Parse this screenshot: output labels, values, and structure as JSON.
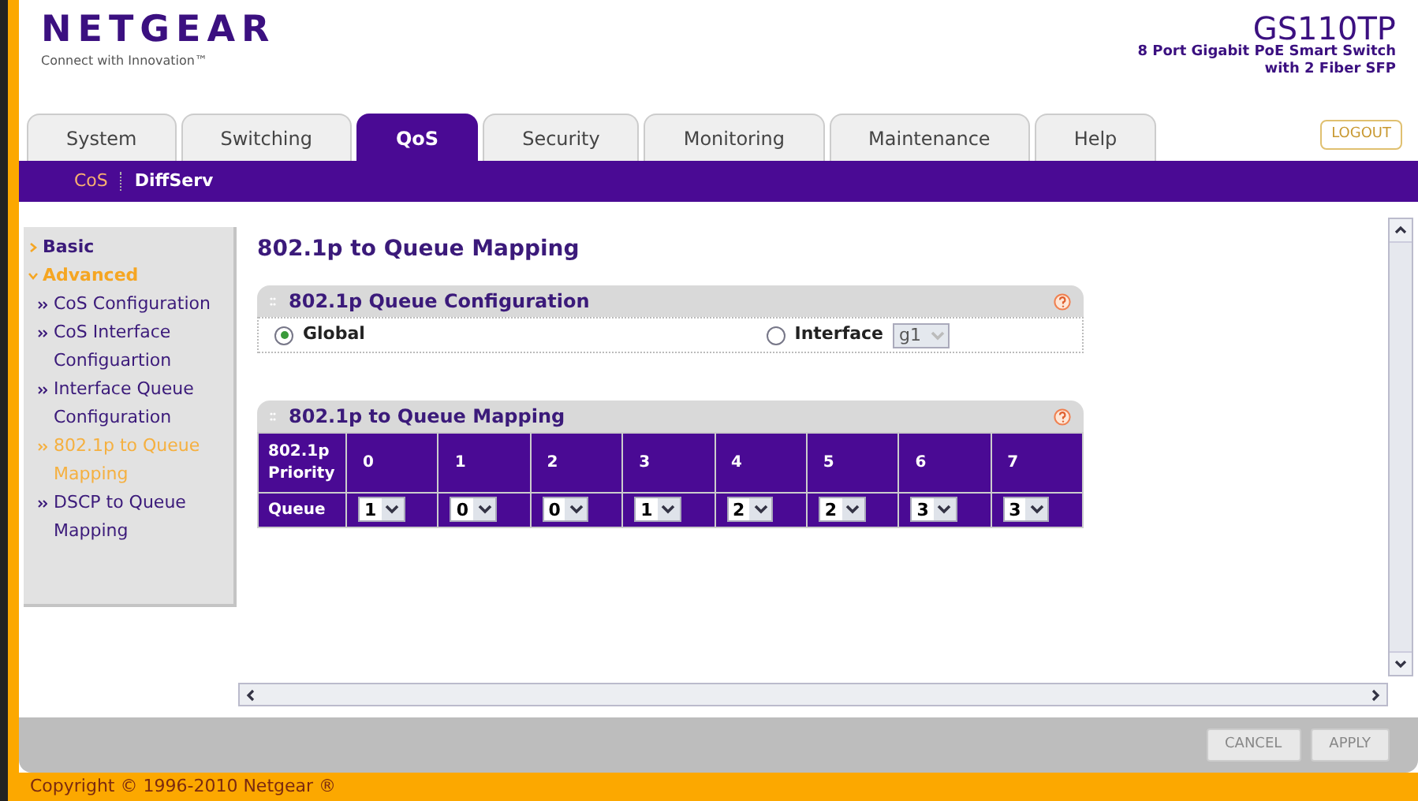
{
  "header": {
    "logo": "NETGEAR",
    "tagline": "Connect with Innovation™",
    "model": "GS110TP",
    "model_lines": [
      "8 Port Gigabit PoE Smart Switch",
      "with 2 Fiber SFP"
    ]
  },
  "tabs": [
    {
      "label": "System",
      "selected": false
    },
    {
      "label": "Switching",
      "selected": false
    },
    {
      "label": "QoS",
      "selected": true
    },
    {
      "label": "Security",
      "selected": false
    },
    {
      "label": "Monitoring",
      "selected": false
    },
    {
      "label": "Maintenance",
      "selected": false
    },
    {
      "label": "Help",
      "selected": false
    }
  ],
  "logout": "LOGOUT",
  "subnav": [
    {
      "label": "CoS",
      "selected": true
    },
    {
      "label": "DiffServ",
      "selected": false
    }
  ],
  "sidebar": [
    {
      "label": "Basic",
      "expanded": false,
      "selected": false
    },
    {
      "label": "Advanced",
      "expanded": true,
      "selected": true,
      "children": [
        {
          "label": "CoS Configuration",
          "selected": false
        },
        {
          "label": "CoS Interface Configuartion",
          "selected": false
        },
        {
          "label": "Interface Queue Configuration",
          "selected": false
        },
        {
          "label": "802.1p to Queue Mapping",
          "selected": true
        },
        {
          "label": "DSCP to Queue Mapping",
          "selected": false
        }
      ]
    }
  ],
  "page_title": "802.1p to Queue Mapping",
  "config_panel": {
    "title": "802.1p Queue Configuration",
    "options": [
      {
        "label": "Global",
        "selected": true
      },
      {
        "label": "Interface",
        "selected": false
      }
    ],
    "interface_value": "g1",
    "interface_disabled": true
  },
  "mapping_panel": {
    "title": "802.1p to Queue Mapping",
    "row_header": "802.1p Priority",
    "row_label": "Queue",
    "columns": [
      {
        "priority": "0",
        "queue": "1"
      },
      {
        "priority": "1",
        "queue": "0"
      },
      {
        "priority": "2",
        "queue": "0"
      },
      {
        "priority": "3",
        "queue": "1"
      },
      {
        "priority": "4",
        "queue": "2"
      },
      {
        "priority": "5",
        "queue": "2"
      },
      {
        "priority": "6",
        "queue": "3"
      },
      {
        "priority": "7",
        "queue": "3"
      }
    ]
  },
  "buttons": [
    "CANCEL",
    "APPLY"
  ],
  "footer": "Copyright © 1996-2010 Netgear ®"
}
